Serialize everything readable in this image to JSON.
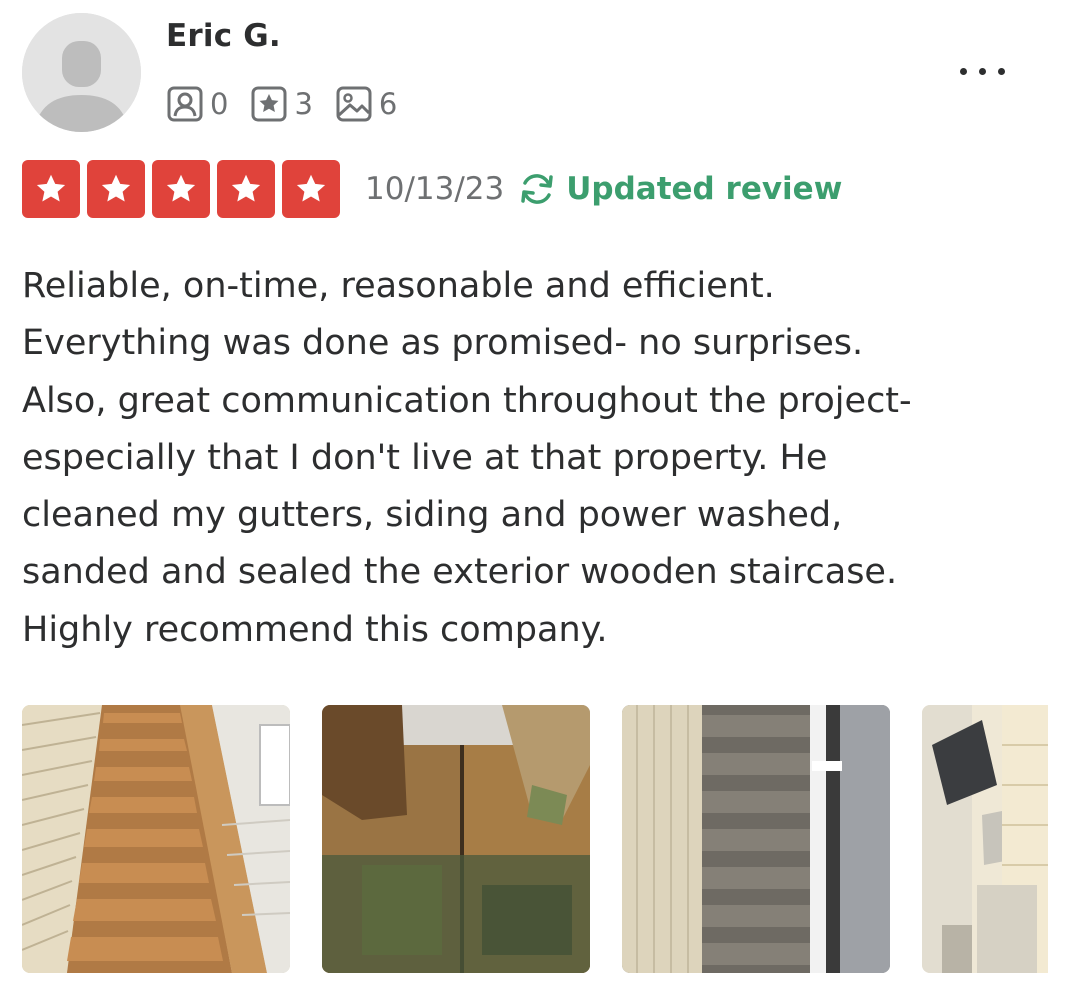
{
  "user": {
    "name": "Eric G.",
    "stats": [
      {
        "icon": "friends-icon",
        "value": "0"
      },
      {
        "icon": "reviews-icon",
        "value": "3"
      },
      {
        "icon": "photos-icon",
        "value": "6"
      }
    ]
  },
  "review": {
    "rating": 5,
    "date": "10/13/23",
    "updated_label": "Updated review",
    "text": "Reliable, on-time, reasonable and efficient.\nEverything was done as promised- no surprises.\nAlso, great communication throughout the project-\nespecially that I don't live at that property. He\ncleaned my gutters, siding and power washed,\nsanded and sealed the exterior wooden staircase.\nHighly recommend this company.",
    "photos": [
      {
        "subject": "wooden-staircase"
      },
      {
        "subject": "deck-boards"
      },
      {
        "subject": "gutter-and-stairs"
      },
      {
        "subject": "building-exterior"
      }
    ]
  },
  "colors": {
    "star_red": "#e0433b",
    "updated_green": "#3c9e6e",
    "text_dark": "#2d2e2f",
    "text_gray": "#6e7072"
  }
}
